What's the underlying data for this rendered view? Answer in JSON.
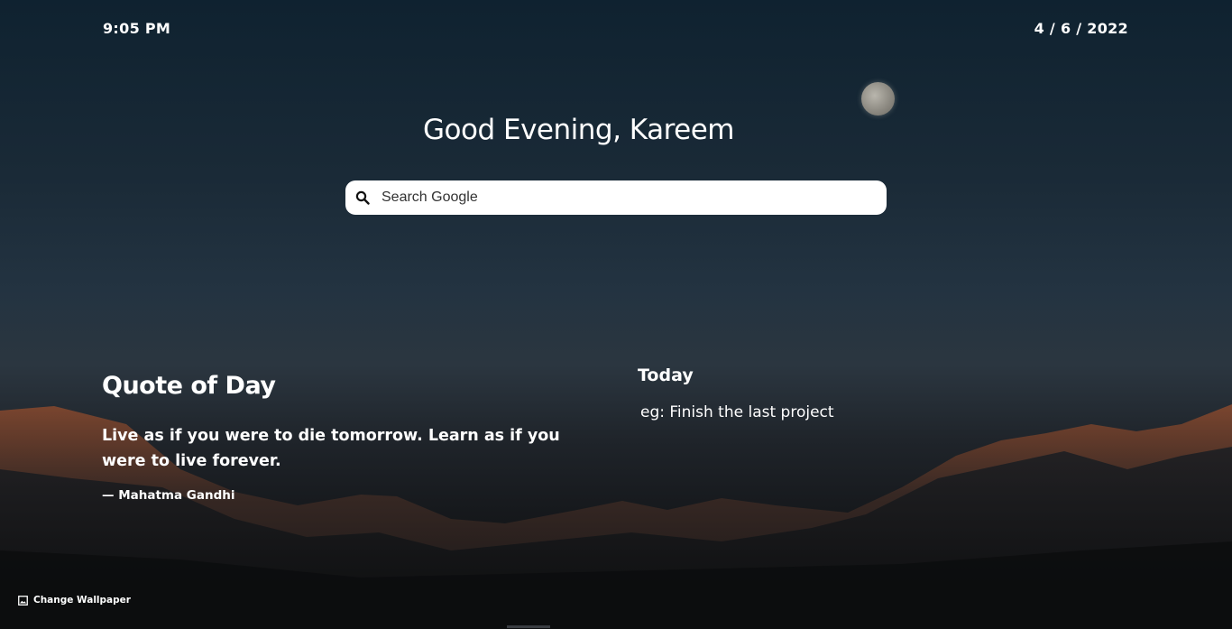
{
  "header": {
    "time": "9:05 PM",
    "date": "4 / 6 / 2022"
  },
  "greeting": "Good Evening, Kareem",
  "search": {
    "placeholder": "Search Google",
    "icon": "search-icon"
  },
  "quote": {
    "title": "Quote of Day",
    "text": "Live as if you were to die tomorrow. Learn as if you were to live forever.",
    "author": "— Mahatma Gandhi"
  },
  "today": {
    "title": "Today",
    "todo_placeholder": "eg: Finish the last project"
  },
  "footer": {
    "change_wallpaper_label": "Change Wallpaper",
    "icon": "image-icon"
  }
}
